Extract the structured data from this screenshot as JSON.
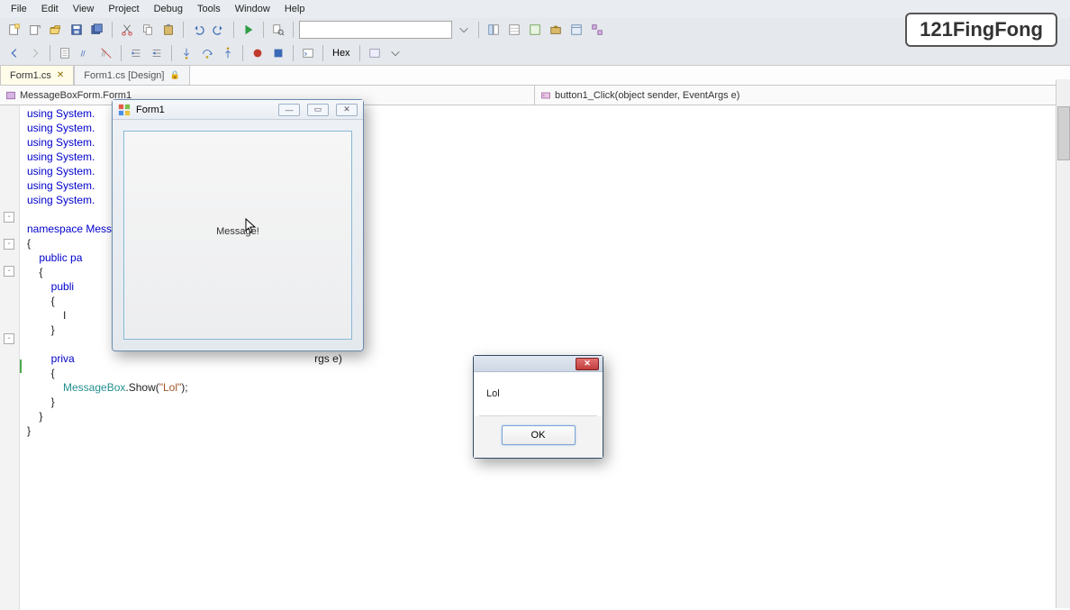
{
  "menu": {
    "items": [
      "File",
      "Edit",
      "View",
      "Project",
      "Debug",
      "Tools",
      "Window",
      "Help"
    ]
  },
  "watermark": "121FingFong",
  "toolbar1": {
    "dropdown_value": "",
    "hex_label": "Hex"
  },
  "tabs": [
    {
      "label": "Form1.cs",
      "active": true,
      "close": "✕"
    },
    {
      "label": "Form1.cs [Design]",
      "active": false,
      "lock": "🔒"
    }
  ],
  "nav": {
    "left": {
      "icon": "class-icon",
      "text": "MessageBoxForm.Form1"
    },
    "right": {
      "icon": "method-icon",
      "text": "button1_Click(object sender, EventArgs e)"
    }
  },
  "code": {
    "l1": "using System.",
    "l2": "using System.",
    "l3": "using System.",
    "l4": "using System.",
    "l5": "using System.",
    "l6": "using System.",
    "l7": "using System.",
    "l8": "",
    "l9": "namespace Mess",
    "l10": "{",
    "l11": "    public pa",
    "l12": "    {",
    "l13": "        publi",
    "l14": "        {",
    "l15": "            I",
    "l16": "        }",
    "l17": "",
    "l18": "        priva",
    "l18b": "rgs e)",
    "l19": "        {",
    "l20_a": "            ",
    "l20_cls": "MessageBox",
    "l20_b": ".Show(",
    "l20_str": "\"Lol\"",
    "l20_c": ");",
    "l21": "        }",
    "l22": "    }",
    "l23": "}"
  },
  "form1": {
    "title": "Form1",
    "button_label": "Message!"
  },
  "msgbox": {
    "text": "Lol",
    "ok": "OK"
  }
}
